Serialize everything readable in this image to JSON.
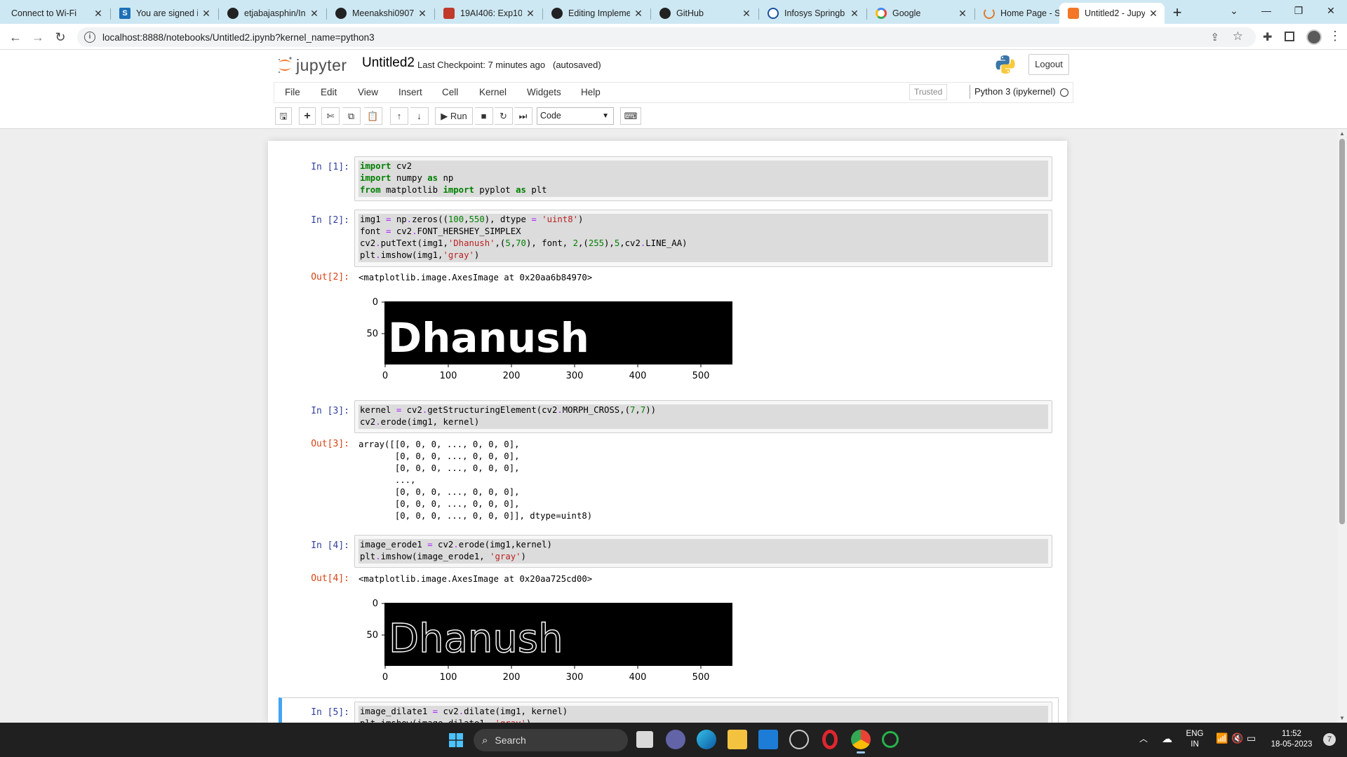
{
  "browser": {
    "tabs": [
      {
        "title": "Connect to Wi-Fi",
        "icon": "wifi-portal-icon",
        "color": "#8ab4c4"
      },
      {
        "title": "You are signed in",
        "icon": "s-logo-icon",
        "color": "#1d6fb8"
      },
      {
        "title": "etjabajasphin/In",
        "icon": "github-icon",
        "color": "#222222"
      },
      {
        "title": "Meenakshi0907",
        "icon": "github-icon",
        "color": "#222222"
      },
      {
        "title": "19AI406: Exp10",
        "icon": "course-icon",
        "color": "#c0392b"
      },
      {
        "title": "Editing Impleme",
        "icon": "github-icon",
        "color": "#222222"
      },
      {
        "title": "GitHub",
        "icon": "github-icon",
        "color": "#222222"
      },
      {
        "title": "Infosys Springb",
        "icon": "infosys-icon",
        "color": "#1a4f9c"
      },
      {
        "title": "Google",
        "icon": "google-icon",
        "color": "#4285f4"
      },
      {
        "title": "Home Page - Se",
        "icon": "loading-icon",
        "color": "#e07a2e"
      },
      {
        "title": "Untitled2 - Jupy",
        "icon": "jupyter-icon",
        "color": "#f37726"
      }
    ],
    "url": "localhost:8888/notebooks/Untitled2.ipynb?kernel_name=python3"
  },
  "jupyter": {
    "logo_text": "jupyter",
    "notebook_name": "Untitled2",
    "checkpoint": "Last Checkpoint: 7 minutes ago",
    "autosave": "(autosaved)",
    "logout": "Logout",
    "menu": [
      "File",
      "Edit",
      "View",
      "Insert",
      "Cell",
      "Kernel",
      "Widgets",
      "Help"
    ],
    "trusted": "Trusted",
    "kernel": "Python 3 (ipykernel)",
    "toolbar": {
      "run_label": "Run",
      "cell_type": "Code"
    }
  },
  "cells": {
    "c1": {
      "prompt": "In [1]:"
    },
    "c2": {
      "prompt": "In [2]:",
      "out_prompt": "Out[2]:",
      "out_text": "<matplotlib.image.AxesImage at 0x20aa6b84970>"
    },
    "c3": {
      "prompt": "In [3]:",
      "out_prompt": "Out[3]:",
      "out_lines": [
        "array([[0, 0, 0, ..., 0, 0, 0],",
        "       [0, 0, 0, ..., 0, 0, 0],",
        "       [0, 0, 0, ..., 0, 0, 0],",
        "       ...,",
        "       [0, 0, 0, ..., 0, 0, 0],",
        "       [0, 0, 0, ..., 0, 0, 0],",
        "       [0, 0, 0, ..., 0, 0, 0]], dtype=uint8)"
      ]
    },
    "c4": {
      "prompt": "In [4]:",
      "out_prompt": "Out[4]:",
      "out_text": "<matplotlib.image.AxesImage at 0x20aa725cd00>"
    },
    "c5": {
      "prompt": "In [5]:"
    }
  },
  "plots": {
    "p1": {
      "text": "Dhanush",
      "xticks": [
        "0",
        "100",
        "200",
        "300",
        "400",
        "500"
      ],
      "yticks": [
        "0",
        "50"
      ]
    },
    "p2": {
      "text": "Dhanush",
      "xticks": [
        "0",
        "100",
        "200",
        "300",
        "400",
        "500"
      ],
      "yticks": [
        "0",
        "50"
      ]
    }
  },
  "taskbar": {
    "search": "Search",
    "lang_top": "ENG",
    "lang_bottom": "IN",
    "time": "11:52",
    "date": "18-05-2023",
    "notifications": "7"
  }
}
